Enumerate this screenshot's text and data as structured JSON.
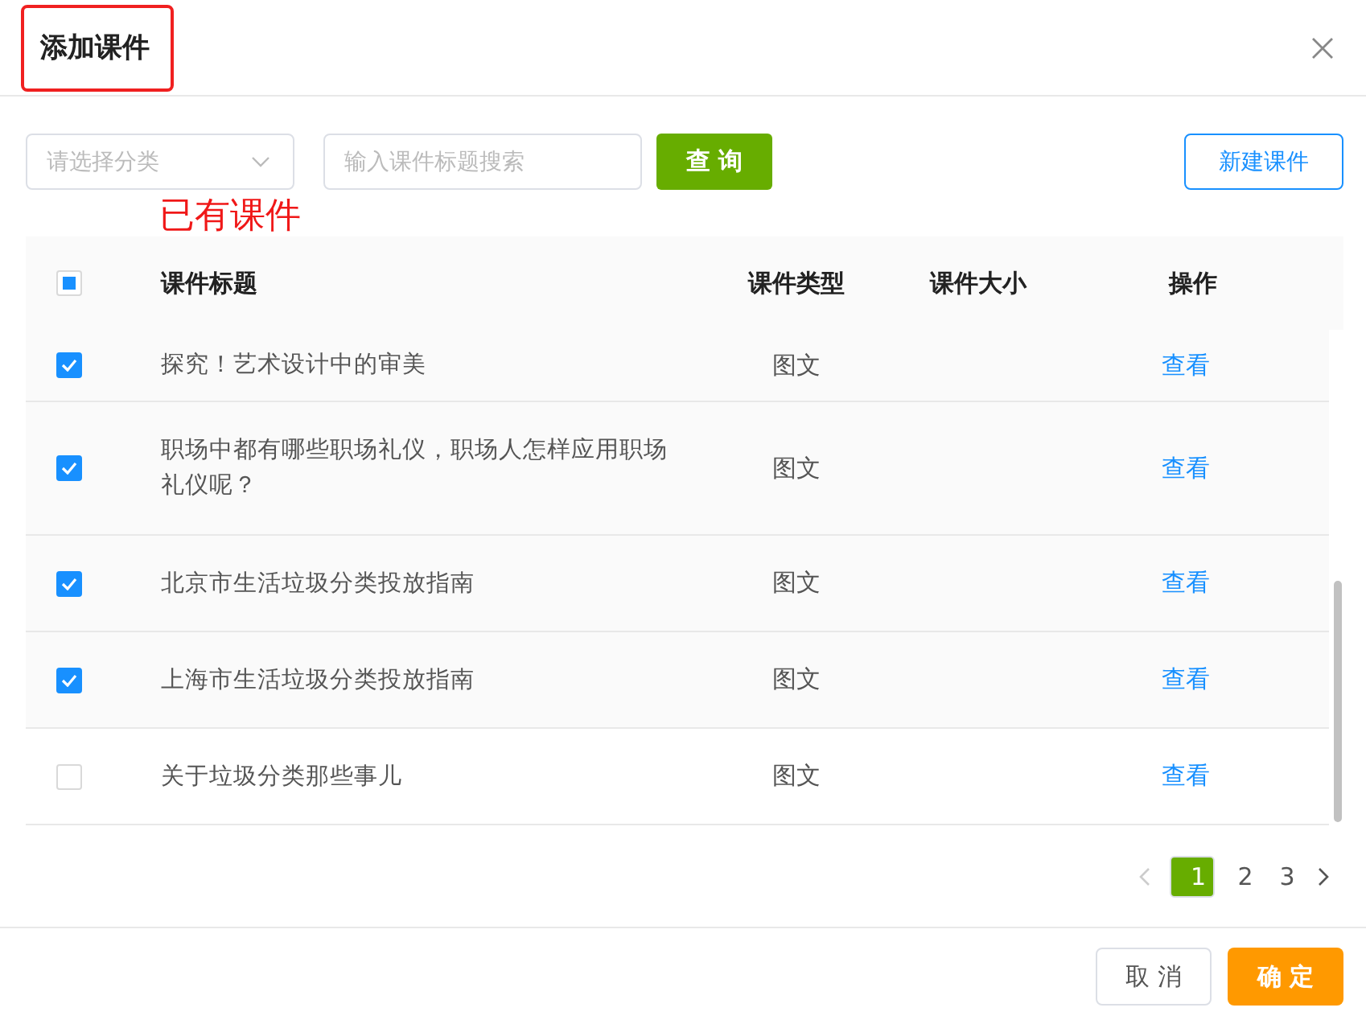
{
  "dialog": {
    "title": "添加课件",
    "title_highlighted": true
  },
  "toolbar": {
    "category": {
      "placeholder": "请选择分类"
    },
    "search": {
      "placeholder": "输入课件标题搜索"
    },
    "query_button": "查 询",
    "new_button": "新建课件"
  },
  "annotation": "已有课件",
  "table": {
    "select_all": {
      "indeterminate": true
    },
    "columns": [
      "课件标题",
      "课件类型",
      "课件大小",
      "操作"
    ],
    "rows": [
      {
        "title": "探究！艺术设计中的审美",
        "type": "图文",
        "action": "查看",
        "checked": true
      },
      {
        "title": "职场中都有哪些职场礼仪，职场人怎样应用职场礼仪呢？",
        "type": "图文",
        "action": "查看",
        "checked": true
      },
      {
        "title": "北京市生活垃圾分类投放指南",
        "type": "图文",
        "action": "查看",
        "checked": true
      },
      {
        "title": "上海市生活垃圾分类投放指南",
        "type": "图文",
        "action": "查看",
        "checked": true
      },
      {
        "title": "关于垃圾分类那些事儿",
        "type": "图文",
        "action": "查看",
        "checked": false
      }
    ]
  },
  "pagination": {
    "pages": [
      {
        "label": "1",
        "selected": true
      },
      {
        "label": "2",
        "selected": false
      },
      {
        "label": "3",
        "selected": false
      }
    ]
  },
  "footer": {
    "buttons": [
      {
        "label": "取 消",
        "kind": "cancel"
      },
      {
        "label": "确 定",
        "kind": "confirm"
      }
    ]
  }
}
